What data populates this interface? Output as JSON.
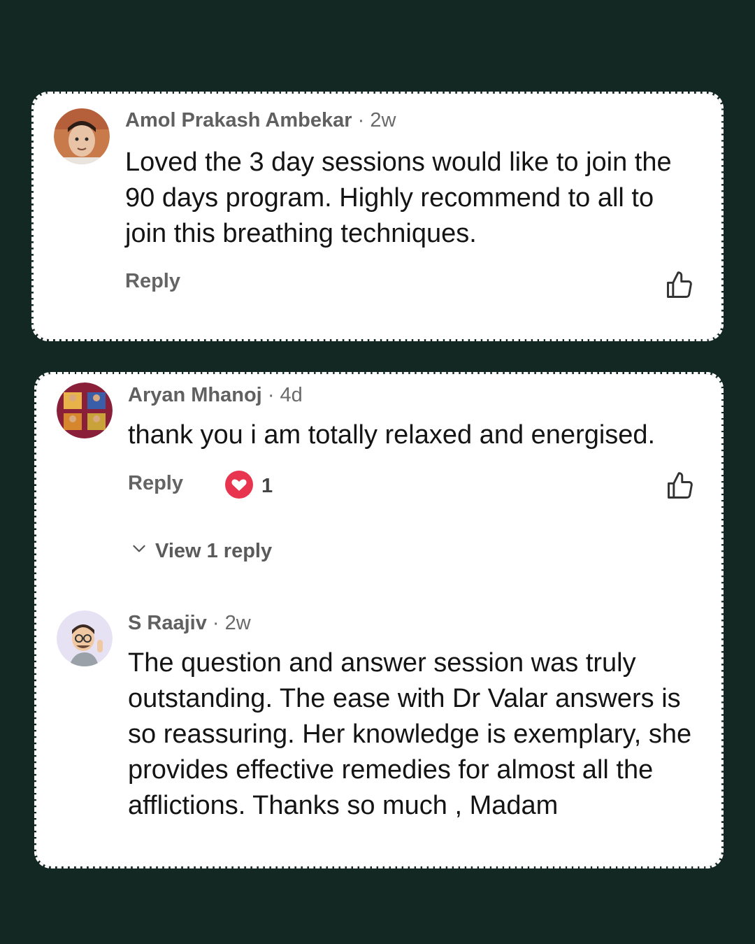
{
  "comments": [
    {
      "author": "Amol Prakash Ambekar",
      "separator": "·",
      "time": "2w",
      "text": "Loved the 3 day sessions would like to join the 90 days program. Highly recommend to all to join this breathing techniques.",
      "reply_label": "Reply"
    },
    {
      "author": "Aryan Mhanoj",
      "separator": "·",
      "time": "4d",
      "text": "thank you i am totally relaxed and energised.",
      "reply_label": "Reply",
      "heart_count": "1",
      "view_replies_label": "View 1 reply"
    },
    {
      "author": "S Raajiv",
      "separator": "·",
      "time": "2w",
      "text": "The question and answer session was truly outstanding. The ease with Dr Valar answers is so reassuring. Her knowledge is exemplary, she  provides effective remedies for almost all the afflictions. Thanks so much , Madam"
    }
  ],
  "colors": {
    "background": "#132723",
    "card": "#ffffff",
    "heart": "#e8344e"
  }
}
